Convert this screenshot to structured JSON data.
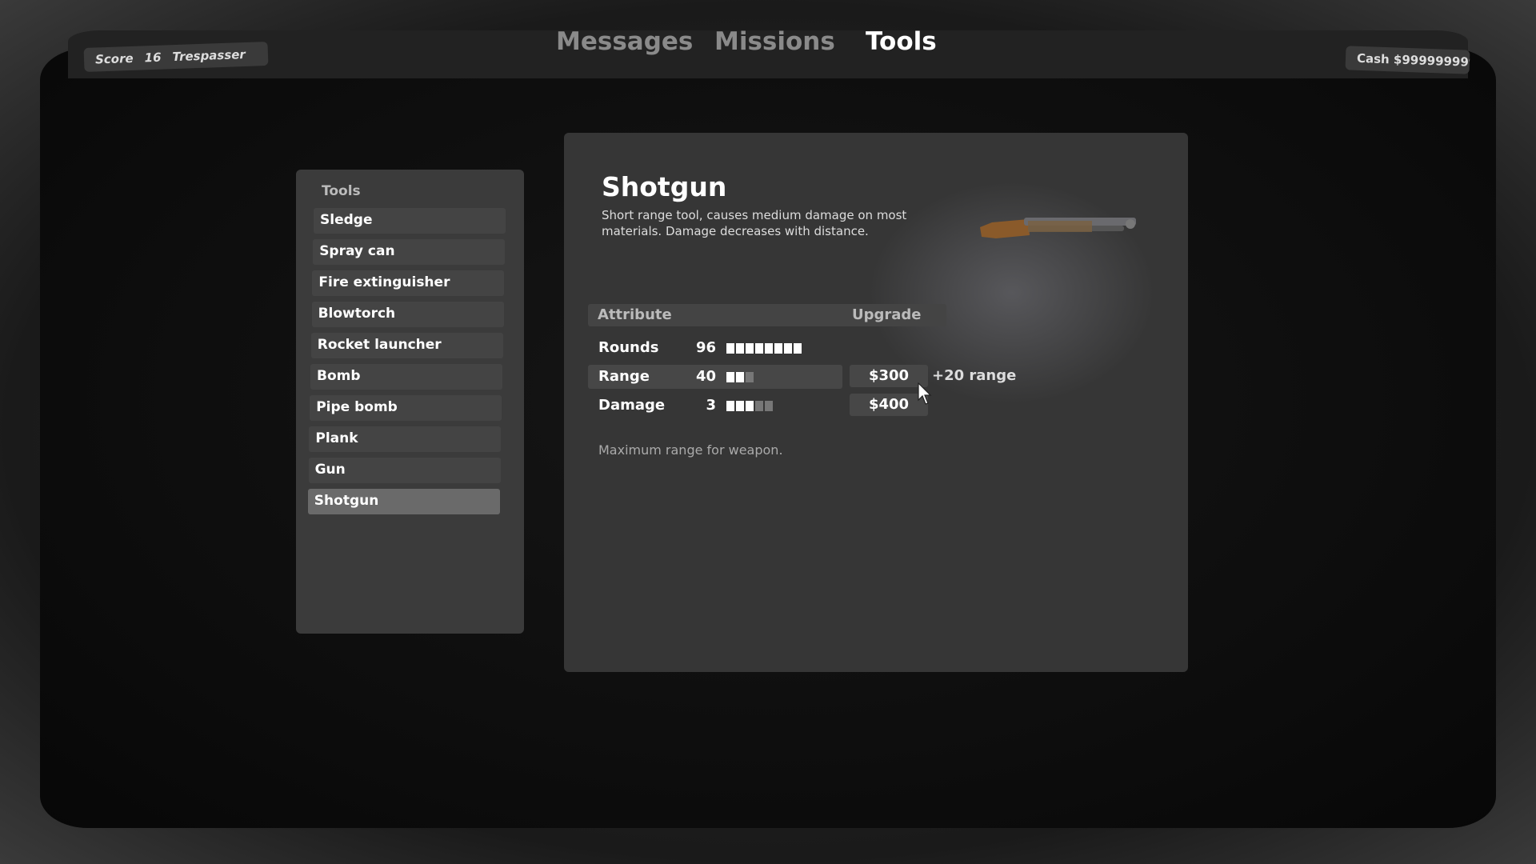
{
  "topbar": {
    "score_label": "Score",
    "score_value": "16",
    "rank": "Trespasser",
    "cash": "Cash $999999999",
    "tabs": [
      {
        "label": "Messages",
        "active": false
      },
      {
        "label": "Missions",
        "active": false
      },
      {
        "label": "Tools",
        "active": true
      }
    ]
  },
  "sidebar": {
    "heading": "Tools",
    "items": [
      {
        "label": "Sledge"
      },
      {
        "label": "Spray can"
      },
      {
        "label": "Fire extinguisher"
      },
      {
        "label": "Blowtorch"
      },
      {
        "label": "Rocket launcher"
      },
      {
        "label": "Bomb"
      },
      {
        "label": "Pipe bomb"
      },
      {
        "label": "Plank"
      },
      {
        "label": "Gun"
      },
      {
        "label": "Shotgun",
        "selected": true
      }
    ]
  },
  "detail": {
    "title": "Shotgun",
    "description": "Short range tool, causes medium damage on most materials. Damage decreases with distance.",
    "icon": "shotgun-image",
    "table": {
      "col_attribute": "Attribute",
      "col_upgrade": "Upgrade",
      "rows": [
        {
          "label": "Rounds",
          "value": "96",
          "level": 8,
          "max": 8,
          "price": null
        },
        {
          "label": "Range",
          "value": "40",
          "level": 2,
          "max": 3,
          "price": "$300",
          "upgrade_note": "+20 range",
          "hovered": true
        },
        {
          "label": "Damage",
          "value": "3",
          "level": 3,
          "max": 5,
          "price": "$400"
        }
      ]
    },
    "hint": "Maximum range for weapon."
  }
}
